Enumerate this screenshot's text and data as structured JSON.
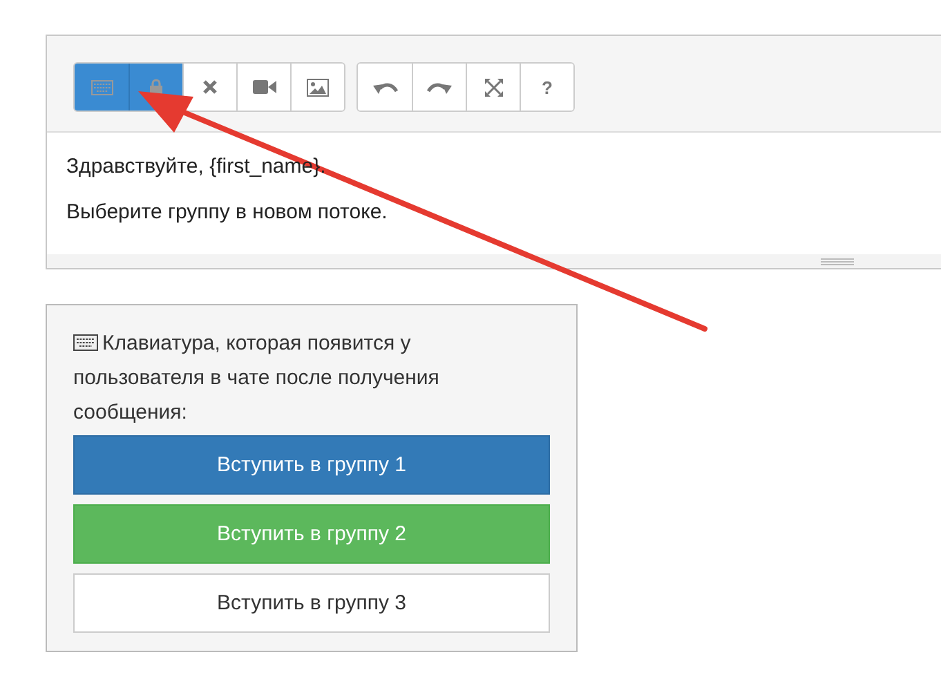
{
  "editor": {
    "toolbar": [
      {
        "group": [
          {
            "kind": "keyboard",
            "selected": true
          },
          {
            "kind": "lock",
            "selected": true
          },
          {
            "kind": "remove",
            "selected": false
          },
          {
            "kind": "video",
            "selected": false
          },
          {
            "kind": "image",
            "selected": false
          }
        ]
      },
      {
        "group": [
          {
            "kind": "undo",
            "selected": false
          },
          {
            "kind": "redo",
            "selected": false
          },
          {
            "kind": "fullscreen",
            "selected": false
          },
          {
            "kind": "help",
            "label": "?",
            "selected": false
          }
        ]
      }
    ],
    "paragraphs": [
      "Здравствуйте, {first_name}.",
      "Выберите группу в новом потоке."
    ]
  },
  "keyboard_preview": {
    "caption": "Клавиатура, которая появится у пользователя в чате после получения сообщения:",
    "buttons": [
      {
        "label": "Вступить в группу 1",
        "kind": "primary"
      },
      {
        "label": "Вступить в группу 2",
        "kind": "success"
      },
      {
        "label": "Вступить в группу 3",
        "kind": "default"
      }
    ]
  }
}
